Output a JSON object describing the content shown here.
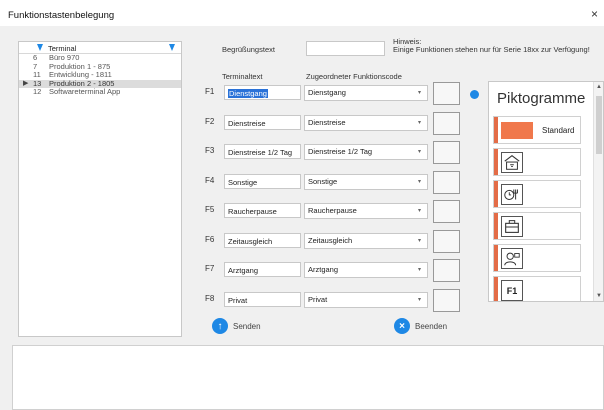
{
  "window": {
    "title": "Funktionstastenbelegung",
    "close_glyph": "×"
  },
  "terminals": {
    "header": "Terminal",
    "rows": [
      {
        "id": "6",
        "name": "Büro 970",
        "selected": false
      },
      {
        "id": "7",
        "name": "Produktion 1 - 875",
        "selected": false
      },
      {
        "id": "11",
        "name": "Entwicklung - 1811",
        "selected": false
      },
      {
        "id": "13",
        "name": "Produktion 2 - 1805",
        "selected": true
      },
      {
        "id": "12",
        "name": "Softwareterminal App",
        "selected": false
      }
    ],
    "selected_marker": "▶"
  },
  "greeting": {
    "label": "Begrüßungstext",
    "value": ""
  },
  "hint": {
    "title": "Hinweis:",
    "text": "Einige Funktionen stehen nur für Serie 18xx zur Verfügung!"
  },
  "columns": {
    "terminal_text": "Terminaltext",
    "function_code": "Zugeordneter Funktionscode"
  },
  "keys": [
    {
      "key": "F1",
      "text": "Dienstgang",
      "code": "Dienstgang"
    },
    {
      "key": "F2",
      "text": "Dienstreise",
      "code": "Dienstreise"
    },
    {
      "key": "F3",
      "text": "Dienstreise 1/2 Tag",
      "code": "Dienstreise 1/2 Tag"
    },
    {
      "key": "F4",
      "text": "Sonstige",
      "code": "Sonstige"
    },
    {
      "key": "F5",
      "text": "Raucherpause",
      "code": "Raucherpause"
    },
    {
      "key": "F6",
      "text": "Zeitausgleich",
      "code": "Zeitausgleich"
    },
    {
      "key": "F7",
      "text": "Arztgang",
      "code": "Arztgang"
    },
    {
      "key": "F8",
      "text": "Privat",
      "code": "Privat"
    }
  ],
  "dropdown_glyph": "▾",
  "pictograms": {
    "title": "Piktogramme",
    "items": [
      {
        "label": "Standard",
        "icon": "orange-swatch"
      },
      {
        "label": "",
        "icon": "building-icon"
      },
      {
        "label": "",
        "icon": "break-icon"
      },
      {
        "label": "",
        "icon": "briefcase-icon"
      },
      {
        "label": "",
        "icon": "doctor-icon"
      },
      {
        "label": "",
        "icon": "f1-key-icon"
      }
    ],
    "f1_text": "F1"
  },
  "actions": {
    "send": "Senden",
    "close": "Beenden"
  },
  "colors": {
    "accent": "#1e88e5",
    "pictogram_bar": "#e36c47",
    "selection": "#2a72d8"
  }
}
